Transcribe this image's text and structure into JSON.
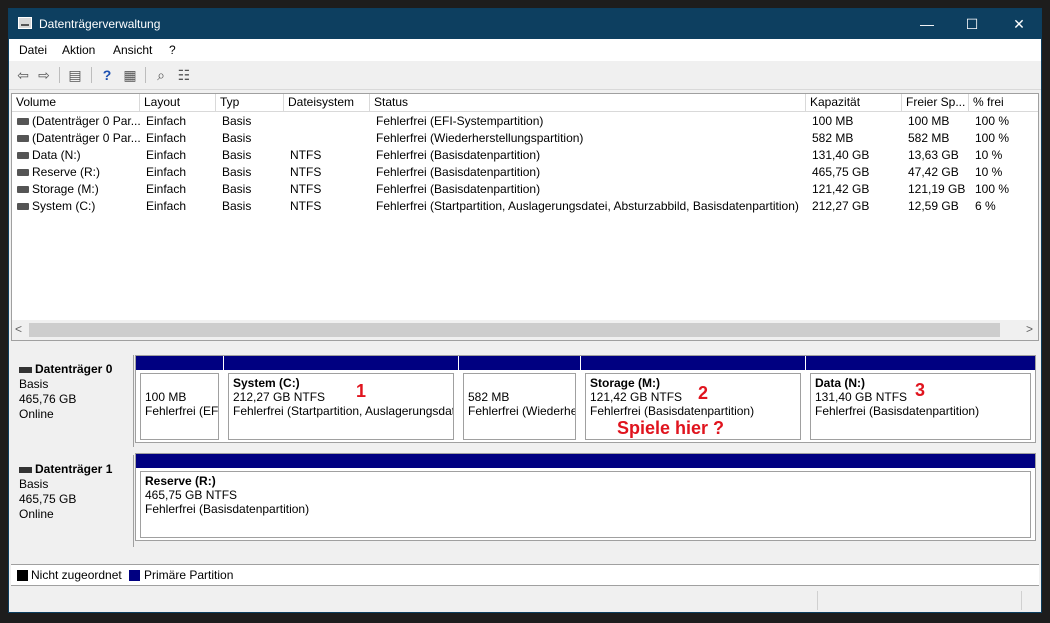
{
  "window": {
    "title": "Datenträgerverwaltung",
    "controls": {
      "minimize": "—",
      "maximize": "☐",
      "close": "✕"
    }
  },
  "menu": [
    "Datei",
    "Aktion",
    "Ansicht",
    "?"
  ],
  "volume_table": {
    "columns": [
      "Volume",
      "Layout",
      "Typ",
      "Dateisystem",
      "Status",
      "Kapazität",
      "Freier Sp...",
      "% frei"
    ],
    "rows": [
      [
        "(Datenträger 0 Par...",
        "Einfach",
        "Basis",
        "",
        "Fehlerfrei (EFI-Systempartition)",
        "100 MB",
        "100 MB",
        "100 %"
      ],
      [
        "(Datenträger 0 Par...",
        "Einfach",
        "Basis",
        "",
        "Fehlerfrei (Wiederherstellungspartition)",
        "582 MB",
        "582 MB",
        "100 %"
      ],
      [
        "Data (N:)",
        "Einfach",
        "Basis",
        "NTFS",
        "Fehlerfrei (Basisdatenpartition)",
        "131,40 GB",
        "13,63 GB",
        "10 %"
      ],
      [
        "Reserve (R:)",
        "Einfach",
        "Basis",
        "NTFS",
        "Fehlerfrei (Basisdatenpartition)",
        "465,75 GB",
        "47,42 GB",
        "10 %"
      ],
      [
        "Storage (M:)",
        "Einfach",
        "Basis",
        "NTFS",
        "Fehlerfrei (Basisdatenpartition)",
        "121,42 GB",
        "121,19 GB",
        "100 %"
      ],
      [
        "System (C:)",
        "Einfach",
        "Basis",
        "NTFS",
        "Fehlerfrei (Startpartition, Auslagerungsdatei, Absturzabbild, Basisdatenpartition)",
        "212,27 GB",
        "12,59 GB",
        "6 %"
      ]
    ]
  },
  "disks": [
    {
      "name": "Datenträger 0",
      "type": "Basis",
      "size": "465,76 GB",
      "state": "Online",
      "partitions": [
        {
          "title": "",
          "size": "100 MB",
          "status": "Fehlerfrei (EFI"
        },
        {
          "title": "System  (C:)",
          "size": "212,27 GB NTFS",
          "status": "Fehlerfrei (Startpartition, Auslagerungsdat"
        },
        {
          "title": "",
          "size": "582 MB",
          "status": "Fehlerfrei (Wiederhe"
        },
        {
          "title": "Storage  (M:)",
          "size": "121,42 GB NTFS",
          "status": "Fehlerfrei (Basisdatenpartition)"
        },
        {
          "title": "Data  (N:)",
          "size": "131,40 GB NTFS",
          "status": "Fehlerfrei (Basisdatenpartition)"
        }
      ]
    },
    {
      "name": "Datenträger 1",
      "type": "Basis",
      "size": "465,75 GB",
      "state": "Online",
      "partitions": [
        {
          "title": "Reserve  (R:)",
          "size": "465,75 GB NTFS",
          "status": "Fehlerfrei (Basisdatenpartition)"
        }
      ]
    }
  ],
  "annotations": [
    "1",
    "2",
    "3",
    "Spiele hier ?"
  ],
  "legend": [
    {
      "label": "Nicht zugeordnet",
      "color": "#000000"
    },
    {
      "label": "Primäre Partition",
      "color": "#000081"
    }
  ],
  "colors": {
    "titlebar": "#0d3f60",
    "primary_partition": "#000081",
    "annotation": "#e0141e"
  }
}
